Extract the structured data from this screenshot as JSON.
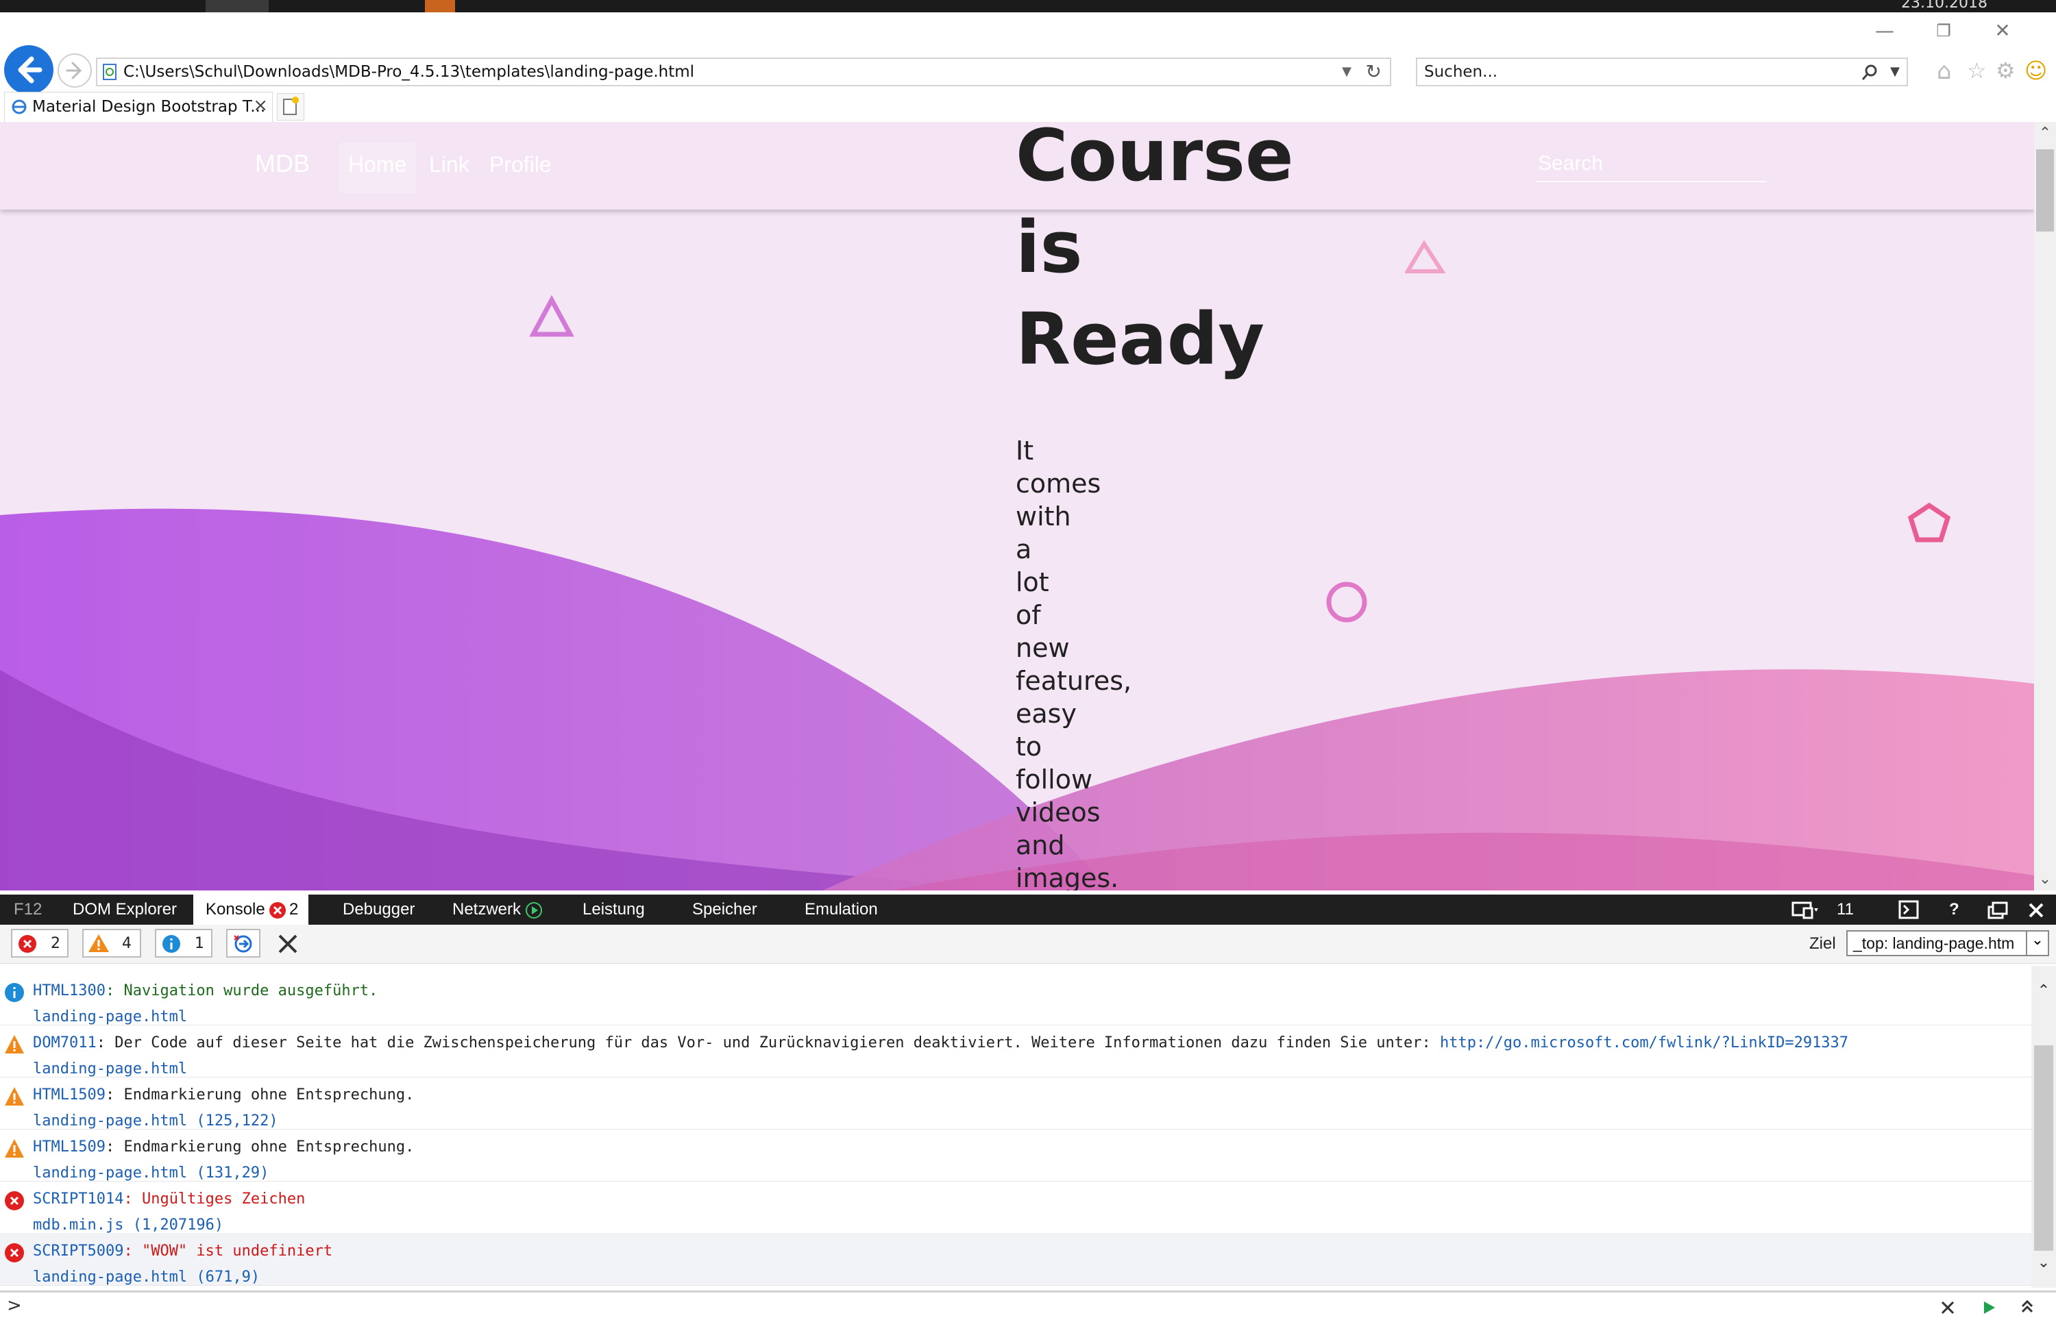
{
  "taskbar": {
    "clock": "23.10.2018"
  },
  "browser": {
    "address": "C:\\Users\\Schul\\Downloads\\MDB-Pro_4.5.13\\templates\\landing-page.html",
    "search_placeholder": "Suchen...",
    "tab_title": "Material Design Bootstrap T...",
    "accent": "#1e73d9"
  },
  "page": {
    "navbar": {
      "brand": "MDB",
      "links": [
        "Home",
        "Link",
        "Profile"
      ],
      "search_placeholder": "Search"
    },
    "hero": {
      "title_lines": [
        "Course",
        "is",
        "Ready"
      ],
      "text_words": [
        "It",
        "comes",
        "with",
        "a",
        "lot",
        "of",
        "new",
        "features,",
        "easy",
        "to",
        "follow",
        "videos",
        "and",
        "images."
      ]
    },
    "colors": {
      "background": "#f5e6f5",
      "wave_purple": "#b45ee0",
      "wave_pink": "#e58fc0"
    }
  },
  "devtools": {
    "tabs": {
      "f12": "F12",
      "dom": "DOM Explorer",
      "console": "Konsole",
      "console_errors": "2",
      "debugger": "Debugger",
      "network": "Netzwerk",
      "performance": "Leistung",
      "memory": "Speicher",
      "emulation": "Emulation"
    },
    "mode_number": "11",
    "filters": {
      "errors": "2",
      "warnings": "4",
      "infos": "1"
    },
    "target_label": "Ziel",
    "target_value": "_top: landing-page.htm",
    "entries": [
      {
        "type": "info",
        "code": "HTML1300",
        "message": "Navigation wurde ausgeführt.",
        "source": "landing-page.html"
      },
      {
        "type": "warn",
        "code": "DOM7011",
        "message": "Der Code auf dieser Seite hat die Zwischenspeicherung für das Vor- und Zurücknavigieren deaktiviert. Weitere Informationen dazu finden Sie unter: ",
        "link": "http://go.microsoft.com/fwlink/?LinkID=291337",
        "source": "landing-page.html"
      },
      {
        "type": "warn",
        "code": "HTML1509",
        "message": "Endmarkierung ohne Entsprechung.",
        "source": "landing-page.html (125,122)"
      },
      {
        "type": "warn",
        "code": "HTML1509",
        "message": "Endmarkierung ohne Entsprechung.",
        "source": "landing-page.html (131,29)"
      },
      {
        "type": "error",
        "code": "SCRIPT1014",
        "message": "Ungültiges Zeichen",
        "source": "mdb.min.js (1,207196)"
      },
      {
        "type": "error",
        "code": "SCRIPT5009",
        "message": "\"WOW\" ist undefiniert",
        "source": "landing-page.html (671,9)"
      }
    ],
    "prompt": ">"
  }
}
